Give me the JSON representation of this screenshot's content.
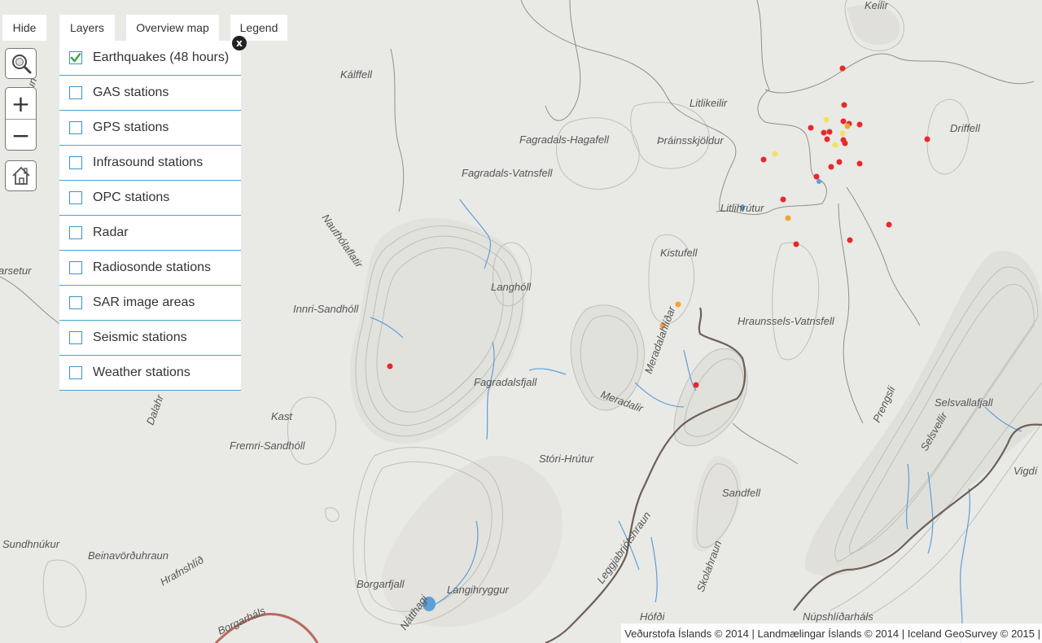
{
  "tabs": {
    "hide": "Hide",
    "layers": "Layers",
    "overview": "Overview map",
    "legend": "Legend"
  },
  "controls": {
    "zoom_in": "+",
    "zoom_out": "−",
    "close": "x",
    "icons": [
      "search-icon",
      "zoom-in-icon",
      "zoom-out-icon",
      "home-icon",
      "close-icon"
    ]
  },
  "layers": [
    {
      "label": "Earthquakes (48 hours)",
      "checked": true
    },
    {
      "label": "GAS stations",
      "checked": false
    },
    {
      "label": "GPS stations",
      "checked": false
    },
    {
      "label": "Infrasound stations",
      "checked": false
    },
    {
      "label": "OPC stations",
      "checked": false
    },
    {
      "label": "Radar",
      "checked": false
    },
    {
      "label": "Radiosonde stations",
      "checked": false
    },
    {
      "label": "SAR image areas",
      "checked": false
    },
    {
      "label": "Seismic stations",
      "checked": false
    },
    {
      "label": "Weather stations",
      "checked": false
    }
  ],
  "map": {
    "place_names": [
      "Keilir",
      "Kálffell",
      "Litlikeilir",
      "Driffell",
      "Fagradals-Hagafell",
      "Þráinsskjöldur",
      "Fagradals-Vatnsfell",
      "Litlihrútur",
      "Nauthólaflatir",
      "arsetur",
      "Kistufell",
      "Langhóll",
      "Innri-Sandhóll",
      "Meradalahlíðar",
      "Hraunssels-Vatnsfell",
      "Fagradalsfjall",
      "Meradalir",
      "Kast",
      "Dalahr",
      "Prengsli",
      "Selsvellir",
      "Selsvallafjall",
      "Fremri-Sandhóll",
      "Stóri-Hrútur",
      "Sandfell",
      "Vigdí",
      "Sundhnúkur",
      "Beinavörðuhraun",
      "Hrafnshlíð",
      "Leggjabrjótshraun",
      "Skolahraun",
      "Borgarfjall",
      "Langihryggur",
      "Hófði",
      "Núpshlíðarháls",
      "Nátthagi",
      "Borgarháls",
      "aun"
    ],
    "colors": {
      "background": "#e9e9e6",
      "contour": "#bfbfba",
      "boundary": "#8f8f8f",
      "water": "#5d9fd6",
      "road": "#7a5a45",
      "quake_recent": "#e8282a",
      "quake_older": "#f2a534",
      "quake_oldest": "#f5e15a"
    },
    "quake_color_key": [
      "recent",
      "older",
      "oldest"
    ]
  },
  "attribution": "Veðurstofa Íslands © 2014 | Landmælingar Íslands © 2014 | Iceland GeoSurvey © 2015 |"
}
